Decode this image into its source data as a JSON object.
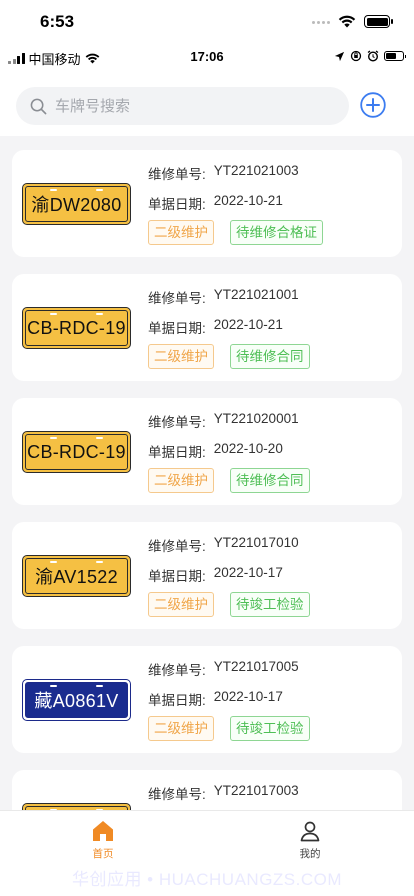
{
  "outer_status": {
    "time": "6:53"
  },
  "inner_status": {
    "carrier": "中国移动",
    "time": "17:06"
  },
  "search": {
    "placeholder": "车牌号搜索"
  },
  "orders": [
    {
      "plate": "渝DW2080",
      "plate_color": "yellow",
      "order_label": "维修单号:",
      "order_no": "YT221021003",
      "date_label": "单据日期:",
      "date": "2022-10-21",
      "level": "二级维护",
      "status": "待维修合格证"
    },
    {
      "plate": "CB-RDC-19",
      "plate_color": "yellow",
      "order_label": "维修单号:",
      "order_no": "YT221021001",
      "date_label": "单据日期:",
      "date": "2022-10-21",
      "level": "二级维护",
      "status": "待维修合同"
    },
    {
      "plate": "CB-RDC-19",
      "plate_color": "yellow",
      "order_label": "维修单号:",
      "order_no": "YT221020001",
      "date_label": "单据日期:",
      "date": "2022-10-20",
      "level": "二级维护",
      "status": "待维修合同"
    },
    {
      "plate": "渝AV1522",
      "plate_color": "yellow",
      "order_label": "维修单号:",
      "order_no": "YT221017010",
      "date_label": "单据日期:",
      "date": "2022-10-17",
      "level": "二级维护",
      "status": "待竣工检验"
    },
    {
      "plate": "藏A0861V",
      "plate_color": "blue",
      "order_label": "维修单号:",
      "order_no": "YT221017005",
      "date_label": "单据日期:",
      "date": "2022-10-17",
      "level": "二级维护",
      "status": "待竣工检验"
    },
    {
      "plate": "",
      "plate_color": "yellow",
      "order_label": "维修单号:",
      "order_no": "YT221017003",
      "date_label": "",
      "date": "",
      "level": "",
      "status": ""
    }
  ],
  "tabbar": {
    "home_label": "首页",
    "me_label": "我的",
    "active_color": "#f08a24"
  },
  "watermark": "华创应用 • HUACHUANGZS.COM"
}
